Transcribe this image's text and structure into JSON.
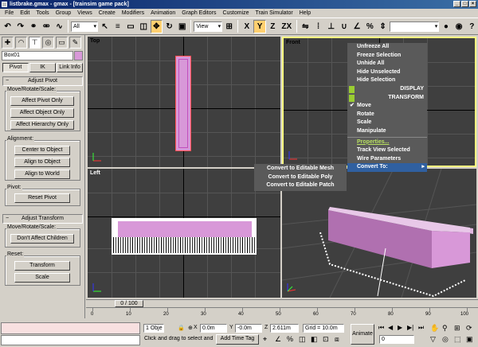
{
  "window": {
    "title": "listbrake.gmax - gmax - [trainsim game pack]"
  },
  "menu": [
    "File",
    "Edit",
    "Tools",
    "Group",
    "Views",
    "Create",
    "Modifiers",
    "Animation",
    "Graph Editors",
    "Customize",
    "Train Simulator",
    "Help"
  ],
  "toolbar": {
    "filter_value": "All",
    "refcoord_value": "View",
    "axes": [
      "X",
      "Y",
      "Z",
      "ZX"
    ]
  },
  "cmdpanel": {
    "object_name": "Box01",
    "modes": {
      "pivot": "Pivot",
      "ik": "IK",
      "link": "Link Info"
    },
    "adjust_pivot": {
      "header": "Adjust Pivot",
      "move_group": "Move/Rotate/Scale:",
      "affect_pivot": "Affect Pivot Only",
      "affect_object": "Affect Object Only",
      "affect_hierarchy": "Affect Hierarchy Only",
      "align_group": "Alignment:",
      "center": "Center to Object",
      "align_object": "Align to Object",
      "align_world": "Align to World",
      "pivot_group": "Pivot:",
      "reset_pivot": "Reset Pivot"
    },
    "adjust_transform": {
      "header": "Adjust Transform",
      "move_group": "Move/Rotate/Scale:",
      "dont_affect": "Don't Affect Children",
      "reset_group": "Reset:",
      "transform": "Transform",
      "scale": "Scale"
    }
  },
  "viewports": {
    "top": "Top",
    "front": "Front",
    "left": "Left"
  },
  "quad_menu": {
    "items_top": [
      "Unfreeze All",
      "Freeze Selection",
      "Unhide All",
      "Hide Unselected",
      "Hide Selection"
    ],
    "display": "DISPLAY",
    "transform": "TRANSFORM",
    "transform_items": [
      "Move",
      "Rotate",
      "Scale",
      "Manipulate"
    ],
    "items_bottom": [
      "Properties...",
      "Track View Selected",
      "Wire Parameters",
      "Convert To:"
    ],
    "submenu": [
      "Convert to Editable Mesh",
      "Convert to Editable Poly",
      "Convert to Editable Patch"
    ]
  },
  "timeline": {
    "slider": "0 / 100",
    "ticks": [
      "0",
      "10",
      "20",
      "30",
      "40",
      "50",
      "60",
      "70",
      "80",
      "90",
      "100"
    ]
  },
  "status": {
    "selected": "1 Obje",
    "prompt": "Click and drag to select and m",
    "add_time_tag": "Add Time Tag",
    "x": "0.0m",
    "y": "-0.0m",
    "z": "2.611m",
    "grid": "Grid = 10.0m",
    "animate": "Animate",
    "frame": "0"
  }
}
